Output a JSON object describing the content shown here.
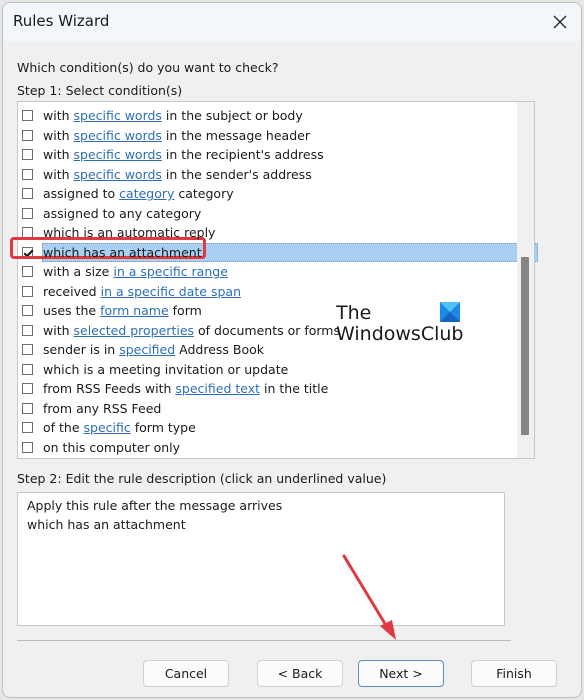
{
  "window": {
    "title": "Rules Wizard",
    "close_icon": "close-icon"
  },
  "step1": {
    "prompt": "Which condition(s) do you want to check?",
    "label": "Step 1: Select condition(s)",
    "conditions": [
      {
        "pre": "with ",
        "link": "specific words",
        "post": " in the subject or body",
        "checked": false
      },
      {
        "pre": "with ",
        "link": "specific words",
        "post": " in the message header",
        "checked": false
      },
      {
        "pre": "with ",
        "link": "specific words",
        "post": " in the recipient's address",
        "checked": false
      },
      {
        "pre": "with ",
        "link": "specific words",
        "post": " in the sender's address",
        "checked": false
      },
      {
        "pre": "assigned to ",
        "link": "category",
        "post": " category",
        "checked": false
      },
      {
        "pre": "assigned to any category",
        "link": "",
        "post": "",
        "checked": false
      },
      {
        "pre": "which is an automatic reply",
        "link": "",
        "post": "",
        "checked": false
      },
      {
        "pre": "which has an attachment",
        "link": "",
        "post": "",
        "checked": true,
        "selected": true
      },
      {
        "pre": "with a size ",
        "link": "in a specific range",
        "post": "",
        "checked": false
      },
      {
        "pre": "received ",
        "link": "in a specific date span",
        "post": "",
        "checked": false
      },
      {
        "pre": "uses the ",
        "link": "form name",
        "post": " form",
        "checked": false
      },
      {
        "pre": "with ",
        "link": "selected properties",
        "post": " of documents or forms",
        "checked": false
      },
      {
        "pre": "sender is in ",
        "link": "specified",
        "post": " Address Book",
        "checked": false
      },
      {
        "pre": "which is a meeting invitation or update",
        "link": "",
        "post": "",
        "checked": false
      },
      {
        "pre": "from RSS Feeds with ",
        "link": "specified text",
        "post": " in the title",
        "checked": false
      },
      {
        "pre": "from any RSS Feed",
        "link": "",
        "post": "",
        "checked": false
      },
      {
        "pre": "of the ",
        "link": "specific",
        "post": " form type",
        "checked": false
      },
      {
        "pre": "on this computer only",
        "link": "",
        "post": "",
        "checked": false
      }
    ]
  },
  "watermark": {
    "line1": "The",
    "line2": "WindowsClub"
  },
  "step2": {
    "label": "Step 2: Edit the rule description (click an underlined value)",
    "description_lines": [
      "Apply this rule after the message arrives",
      "which has an attachment"
    ]
  },
  "buttons": {
    "cancel": "Cancel",
    "back": "< Back",
    "next": "Next >",
    "finish": "Finish"
  },
  "colors": {
    "annotation_red": "#e0383f",
    "selection_blue": "#a8d0f3",
    "link_blue": "#2d6fb5"
  }
}
